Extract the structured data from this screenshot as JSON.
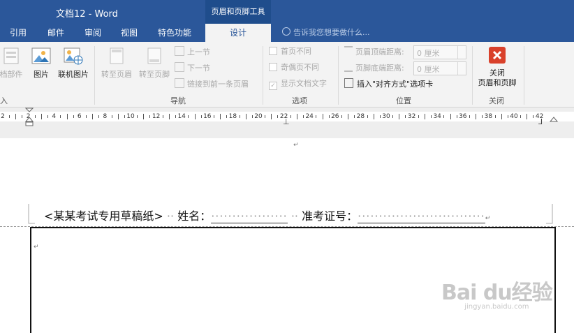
{
  "window": {
    "title": "文档12 - Word",
    "context_tab_group": "页眉和页脚工具"
  },
  "tabs": [
    {
      "label": "引用"
    },
    {
      "label": "邮件"
    },
    {
      "label": "审阅"
    },
    {
      "label": "视图"
    },
    {
      "label": "特色功能"
    },
    {
      "label": "设计",
      "active": true
    }
  ],
  "tell_me": "告诉我您想要做什么...",
  "ribbon": {
    "insert_group": {
      "doc_parts": "档部件",
      "picture": "图片",
      "online_picture": "联机图片",
      "label": "入"
    },
    "nav_group": {
      "goto_header": "转至页眉",
      "goto_footer": "转至页脚",
      "prev_section": "上一节",
      "next_section": "下一节",
      "link_previous": "链接到前一条页眉",
      "label": "导航"
    },
    "options_group": {
      "diff_first": "首页不同",
      "diff_odd_even": "奇偶页不同",
      "show_text": "显示文档文字",
      "label": "选项"
    },
    "position_group": {
      "header_top": "页眉顶端距离:",
      "header_top_value": "0 厘米",
      "footer_bottom": "页脚底端距离:",
      "footer_bottom_value": "0 厘米",
      "insert_align_tab": "插入\"对齐方式\"选项卡",
      "label": "位置"
    },
    "close_group": {
      "close_line1": "关闭",
      "close_line2": "页眉和页脚",
      "label": "关闭"
    }
  },
  "ruler": {
    "numbers": [
      "2",
      "2",
      "4",
      "6",
      "8",
      "10",
      "12",
      "14",
      "16",
      "18",
      "20",
      "22",
      "24",
      "26",
      "28",
      "30",
      "32",
      "34",
      "36",
      "38",
      "40",
      "42"
    ]
  },
  "document": {
    "paragraph_mark": "↵",
    "header_text": "<某某考试专用草稿纸>",
    "name_label": "姓名：",
    "exam_label": "准考证号：",
    "name_blank": "··················",
    "exam_blank": "······························"
  },
  "watermark": {
    "main": "Bai du经验",
    "sub": "jingyan.baidu.com"
  },
  "colors": {
    "word_blue": "#2b579a",
    "close_red": "#d9412b",
    "ribbon_bg": "#f3f3f3"
  }
}
